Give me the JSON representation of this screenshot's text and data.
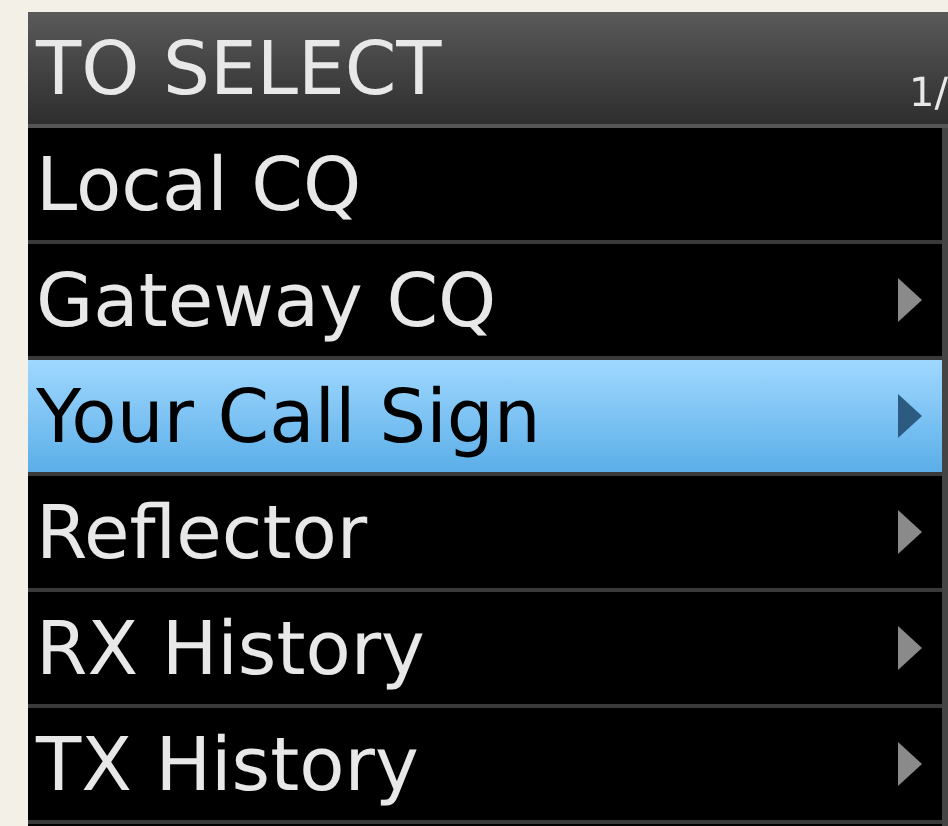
{
  "title": "TO SELECT",
  "page": "1/",
  "items": [
    {
      "label": "Local CQ",
      "submenu": false,
      "selected": false
    },
    {
      "label": "Gateway CQ",
      "submenu": true,
      "selected": false
    },
    {
      "label": "Your Call Sign",
      "submenu": true,
      "selected": true
    },
    {
      "label": "Reflector",
      "submenu": true,
      "selected": false
    },
    {
      "label": "RX History",
      "submenu": true,
      "selected": false
    },
    {
      "label": "TX History",
      "submenu": true,
      "selected": false
    }
  ]
}
